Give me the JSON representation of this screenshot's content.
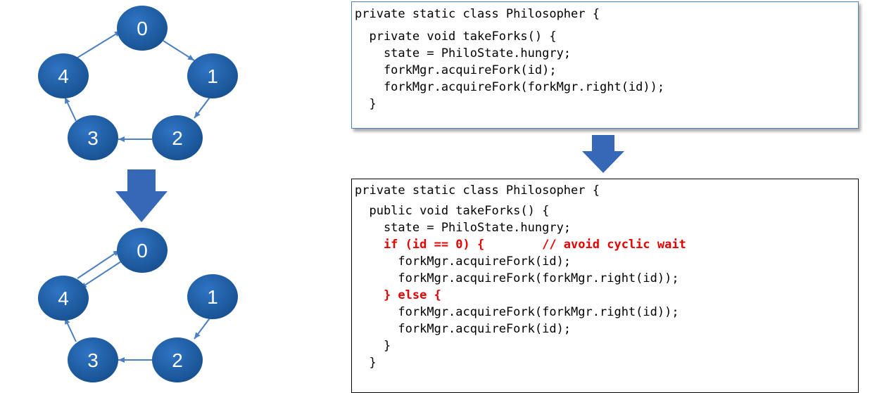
{
  "nodes": [
    "0",
    "1",
    "2",
    "3",
    "4"
  ],
  "colors": {
    "node": "#1f5ea8",
    "arrow": "#4a7fc1",
    "big_arrow": "#3568b7",
    "highlight": "#e60000"
  },
  "top_code": [
    {
      "text": "private static class Philosopher {",
      "hl": false
    },
    {
      "text": "  private void takeForks() {",
      "hl": false
    },
    {
      "text": "    state = PhiloState.hungry;",
      "hl": false
    },
    {
      "text": "    forkMgr.acquireFork(id);",
      "hl": false
    },
    {
      "text": "    forkMgr.acquireFork(forkMgr.right(id));",
      "hl": false
    },
    {
      "text": "  }",
      "hl": false
    }
  ],
  "bottom_code": [
    {
      "text": "private static class Philosopher {",
      "hl": false
    },
    {
      "text": "  public void takeForks() {",
      "hl": false
    },
    {
      "text": "    state = PhiloState.hungry;",
      "hl": false
    },
    {
      "text": "    if (id == 0) {        // avoid cyclic wait",
      "hl": true
    },
    {
      "text": "      forkMgr.acquireFork(id);",
      "hl": false
    },
    {
      "text": "      forkMgr.acquireFork(forkMgr.right(id));",
      "hl": false
    },
    {
      "text": "    } else {",
      "hl": true
    },
    {
      "text": "      forkMgr.acquireFork(forkMgr.right(id));",
      "hl": false
    },
    {
      "text": "      forkMgr.acquireFork(id);",
      "hl": false
    },
    {
      "text": "    }",
      "hl": false
    },
    {
      "text": "  }",
      "hl": false
    }
  ]
}
